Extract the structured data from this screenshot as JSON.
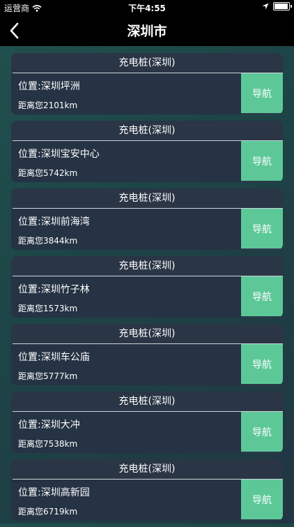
{
  "status_bar": {
    "carrier": "运营商",
    "time": "下午4:55",
    "battery_level": 0.95
  },
  "nav": {
    "title": "深圳市"
  },
  "stations": [
    {
      "title": "充电桩(深圳)",
      "location": "位置:深圳坪洲",
      "distance": "距离您2101km",
      "action": "导航"
    },
    {
      "title": "充电桩(深圳)",
      "location": "位置:深圳宝安中心",
      "distance": "距离您5742km",
      "action": "导航"
    },
    {
      "title": "充电桩(深圳)",
      "location": "位置:深圳前海湾",
      "distance": "距离您3844km",
      "action": "导航"
    },
    {
      "title": "充电桩(深圳)",
      "location": "位置:深圳竹子林",
      "distance": "距离您1573km",
      "action": "导航"
    },
    {
      "title": "充电桩(深圳)",
      "location": "位置:深圳车公庙",
      "distance": "距离您5777km",
      "action": "导航"
    },
    {
      "title": "充电桩(深圳)",
      "location": "位置:深圳大冲",
      "distance": "距离您7538km",
      "action": "导航"
    },
    {
      "title": "充电桩(深圳)",
      "location": "位置:深圳高新园",
      "distance": "距离您6719km",
      "action": "导航"
    }
  ]
}
